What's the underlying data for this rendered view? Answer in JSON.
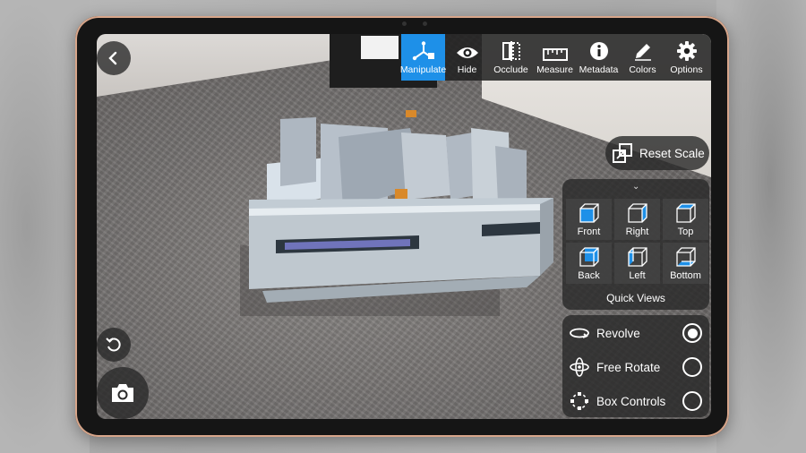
{
  "toolbar": {
    "items": [
      {
        "label": "Manipulate",
        "icon": "manipulate-axes-icon",
        "active": true
      },
      {
        "label": "Hide",
        "icon": "eye-icon",
        "active": false
      },
      {
        "label": "Occlude",
        "icon": "occlude-icon",
        "active": false
      },
      {
        "label": "Measure",
        "icon": "ruler-icon",
        "active": false
      },
      {
        "label": "Metadata",
        "icon": "info-icon",
        "active": false
      },
      {
        "label": "Colors",
        "icon": "pencil-icon",
        "active": false
      },
      {
        "label": "Options",
        "icon": "gear-icon",
        "active": false
      }
    ]
  },
  "reset_scale": {
    "label": "Reset Scale",
    "icon": "resize-squares-icon"
  },
  "quick_views": {
    "title": "Quick Views",
    "items": [
      {
        "label": "Front",
        "icon": "cube-front-icon"
      },
      {
        "label": "Right",
        "icon": "cube-right-icon"
      },
      {
        "label": "Top",
        "icon": "cube-top-icon"
      },
      {
        "label": "Back",
        "icon": "cube-back-icon"
      },
      {
        "label": "Left",
        "icon": "cube-left-icon"
      },
      {
        "label": "Bottom",
        "icon": "cube-bottom-icon"
      }
    ]
  },
  "modes": {
    "items": [
      {
        "label": "Revolve",
        "icon": "revolve-icon",
        "selected": true
      },
      {
        "label": "Free Rotate",
        "icon": "free-rotate-icon",
        "selected": false
      },
      {
        "label": "Box Controls",
        "icon": "box-controls-icon",
        "selected": false
      }
    ]
  },
  "colors": {
    "accent": "#1e90e8",
    "panel": "#282828",
    "bezel": "#151515",
    "bezel_edge": "#d7a58a"
  }
}
